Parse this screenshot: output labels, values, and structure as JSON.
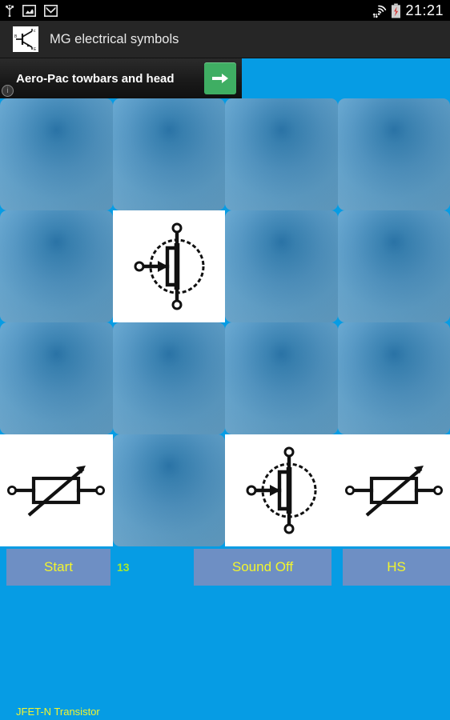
{
  "status_bar": {
    "icons": [
      "usb-icon",
      "screenshot-icon",
      "gmail-icon"
    ],
    "right_icons": [
      "wifi-icon",
      "battery-icon"
    ],
    "clock": "21:21"
  },
  "action_bar": {
    "app_icon": "bjt-transistor-icon",
    "title": "MG electrical symbols"
  },
  "ad": {
    "text": "Aero-Pac towbars and head",
    "cta_icon": "arrow-right-icon",
    "info_icon": "info-icon",
    "info_glyph": "i",
    "cta_color": "#3FAE63"
  },
  "grid": {
    "columns": 4,
    "rows": 4,
    "cards": [
      {
        "state": "facedown",
        "symbol": null,
        "name": null
      },
      {
        "state": "facedown",
        "symbol": null,
        "name": null
      },
      {
        "state": "facedown",
        "symbol": null,
        "name": null
      },
      {
        "state": "facedown",
        "symbol": null,
        "name": null
      },
      {
        "state": "facedown",
        "symbol": null,
        "name": null
      },
      {
        "state": "faceup",
        "symbol": "jfet-n",
        "name": "JFET-N Transistor"
      },
      {
        "state": "facedown",
        "symbol": null,
        "name": null
      },
      {
        "state": "facedown",
        "symbol": null,
        "name": null
      },
      {
        "state": "facedown",
        "symbol": null,
        "name": null
      },
      {
        "state": "facedown",
        "symbol": null,
        "name": null
      },
      {
        "state": "facedown",
        "symbol": null,
        "name": null
      },
      {
        "state": "facedown",
        "symbol": null,
        "name": null
      },
      {
        "state": "faceup",
        "symbol": "variable-resistor",
        "name": "Variable Resistor"
      },
      {
        "state": "facedown",
        "symbol": null,
        "name": null
      },
      {
        "state": "faceup",
        "symbol": "jfet-n",
        "name": "JFET-N Transistor"
      },
      {
        "state": "faceup",
        "symbol": "variable-resistor",
        "name": "Variable Resistor"
      }
    ]
  },
  "buttons": {
    "start": "Start",
    "score": "13",
    "sound": "Sound Off",
    "high_score": "HS",
    "button_color": "#6E8FC4",
    "label_color": "#F2F52E"
  },
  "footer": {
    "answer": "JFET-N Transistor"
  },
  "theme": {
    "background": "#069CE4",
    "card_back": "#4a93c4",
    "card_face": "#FFFFFF",
    "action_bar": "#262626",
    "status_bar": "#000000"
  }
}
